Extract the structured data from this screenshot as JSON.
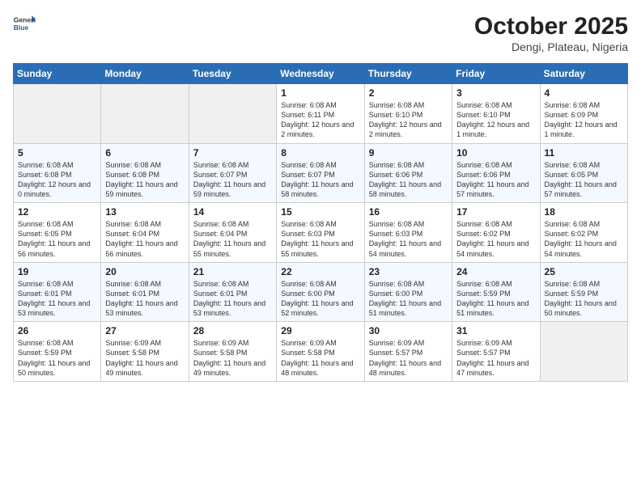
{
  "header": {
    "logo": {
      "general": "General",
      "blue": "Blue"
    },
    "title": "October 2025",
    "subtitle": "Dengi, Plateau, Nigeria"
  },
  "weekdays": [
    "Sunday",
    "Monday",
    "Tuesday",
    "Wednesday",
    "Thursday",
    "Friday",
    "Saturday"
  ],
  "weeks": [
    [
      {
        "day": "",
        "info": ""
      },
      {
        "day": "",
        "info": ""
      },
      {
        "day": "",
        "info": ""
      },
      {
        "day": "1",
        "info": "Sunrise: 6:08 AM\nSunset: 6:11 PM\nDaylight: 12 hours and 2 minutes."
      },
      {
        "day": "2",
        "info": "Sunrise: 6:08 AM\nSunset: 6:10 PM\nDaylight: 12 hours and 2 minutes."
      },
      {
        "day": "3",
        "info": "Sunrise: 6:08 AM\nSunset: 6:10 PM\nDaylight: 12 hours and 1 minute."
      },
      {
        "day": "4",
        "info": "Sunrise: 6:08 AM\nSunset: 6:09 PM\nDaylight: 12 hours and 1 minute."
      }
    ],
    [
      {
        "day": "5",
        "info": "Sunrise: 6:08 AM\nSunset: 6:08 PM\nDaylight: 12 hours and 0 minutes."
      },
      {
        "day": "6",
        "info": "Sunrise: 6:08 AM\nSunset: 6:08 PM\nDaylight: 11 hours and 59 minutes."
      },
      {
        "day": "7",
        "info": "Sunrise: 6:08 AM\nSunset: 6:07 PM\nDaylight: 11 hours and 59 minutes."
      },
      {
        "day": "8",
        "info": "Sunrise: 6:08 AM\nSunset: 6:07 PM\nDaylight: 11 hours and 58 minutes."
      },
      {
        "day": "9",
        "info": "Sunrise: 6:08 AM\nSunset: 6:06 PM\nDaylight: 11 hours and 58 minutes."
      },
      {
        "day": "10",
        "info": "Sunrise: 6:08 AM\nSunset: 6:06 PM\nDaylight: 11 hours and 57 minutes."
      },
      {
        "day": "11",
        "info": "Sunrise: 6:08 AM\nSunset: 6:05 PM\nDaylight: 11 hours and 57 minutes."
      }
    ],
    [
      {
        "day": "12",
        "info": "Sunrise: 6:08 AM\nSunset: 6:05 PM\nDaylight: 11 hours and 56 minutes."
      },
      {
        "day": "13",
        "info": "Sunrise: 6:08 AM\nSunset: 6:04 PM\nDaylight: 11 hours and 56 minutes."
      },
      {
        "day": "14",
        "info": "Sunrise: 6:08 AM\nSunset: 6:04 PM\nDaylight: 11 hours and 55 minutes."
      },
      {
        "day": "15",
        "info": "Sunrise: 6:08 AM\nSunset: 6:03 PM\nDaylight: 11 hours and 55 minutes."
      },
      {
        "day": "16",
        "info": "Sunrise: 6:08 AM\nSunset: 6:03 PM\nDaylight: 11 hours and 54 minutes."
      },
      {
        "day": "17",
        "info": "Sunrise: 6:08 AM\nSunset: 6:02 PM\nDaylight: 11 hours and 54 minutes."
      },
      {
        "day": "18",
        "info": "Sunrise: 6:08 AM\nSunset: 6:02 PM\nDaylight: 11 hours and 54 minutes."
      }
    ],
    [
      {
        "day": "19",
        "info": "Sunrise: 6:08 AM\nSunset: 6:01 PM\nDaylight: 11 hours and 53 minutes."
      },
      {
        "day": "20",
        "info": "Sunrise: 6:08 AM\nSunset: 6:01 PM\nDaylight: 11 hours and 53 minutes."
      },
      {
        "day": "21",
        "info": "Sunrise: 6:08 AM\nSunset: 6:01 PM\nDaylight: 11 hours and 53 minutes."
      },
      {
        "day": "22",
        "info": "Sunrise: 6:08 AM\nSunset: 6:00 PM\nDaylight: 11 hours and 52 minutes."
      },
      {
        "day": "23",
        "info": "Sunrise: 6:08 AM\nSunset: 6:00 PM\nDaylight: 11 hours and 51 minutes."
      },
      {
        "day": "24",
        "info": "Sunrise: 6:08 AM\nSunset: 5:59 PM\nDaylight: 11 hours and 51 minutes."
      },
      {
        "day": "25",
        "info": "Sunrise: 6:08 AM\nSunset: 5:59 PM\nDaylight: 11 hours and 50 minutes."
      }
    ],
    [
      {
        "day": "26",
        "info": "Sunrise: 6:08 AM\nSunset: 5:59 PM\nDaylight: 11 hours and 50 minutes."
      },
      {
        "day": "27",
        "info": "Sunrise: 6:09 AM\nSunset: 5:58 PM\nDaylight: 11 hours and 49 minutes."
      },
      {
        "day": "28",
        "info": "Sunrise: 6:09 AM\nSunset: 5:58 PM\nDaylight: 11 hours and 49 minutes."
      },
      {
        "day": "29",
        "info": "Sunrise: 6:09 AM\nSunset: 5:58 PM\nDaylight: 11 hours and 48 minutes."
      },
      {
        "day": "30",
        "info": "Sunrise: 6:09 AM\nSunset: 5:57 PM\nDaylight: 11 hours and 48 minutes."
      },
      {
        "day": "31",
        "info": "Sunrise: 6:09 AM\nSunset: 5:57 PM\nDaylight: 11 hours and 47 minutes."
      },
      {
        "day": "",
        "info": ""
      }
    ]
  ]
}
